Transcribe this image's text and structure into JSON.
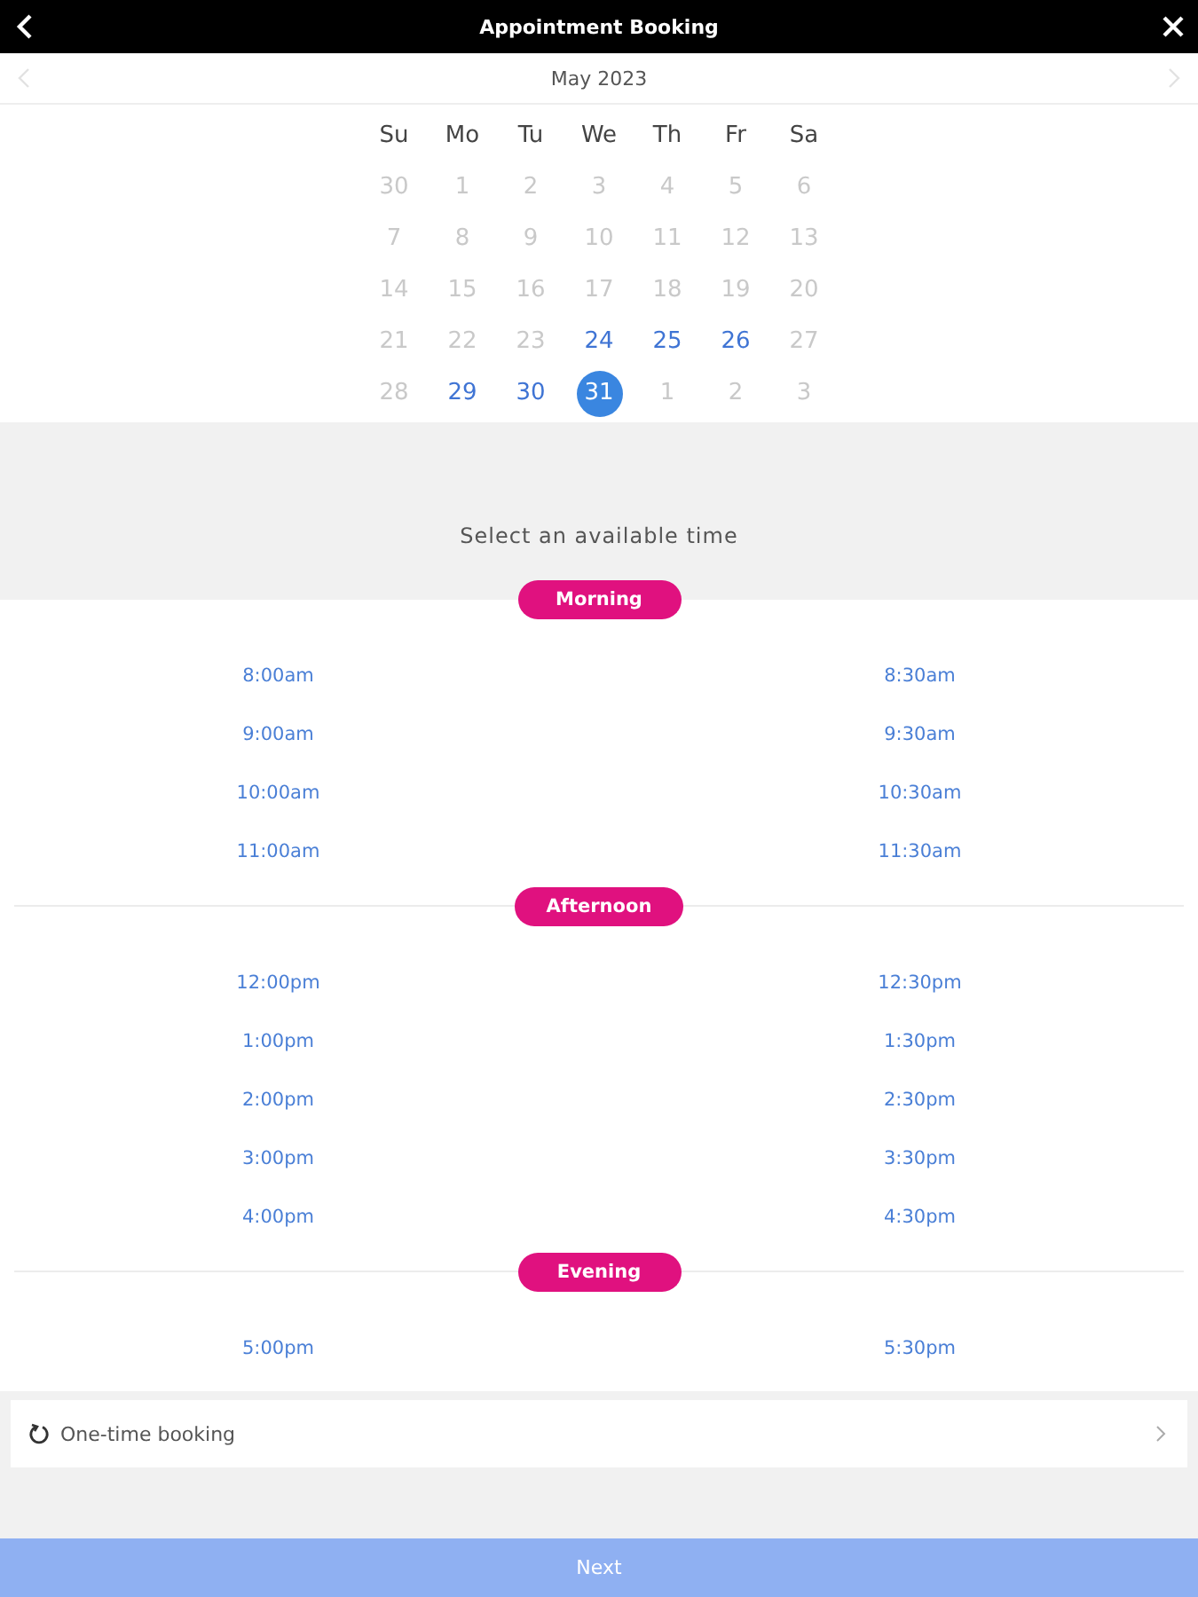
{
  "header": {
    "title": "Appointment Booking"
  },
  "month": {
    "label": "May 2023"
  },
  "weekdays": [
    "Su",
    "Mo",
    "Tu",
    "We",
    "Th",
    "Fr",
    "Sa"
  ],
  "days": [
    {
      "label": "30",
      "available": false,
      "selected": false
    },
    {
      "label": "1",
      "available": false,
      "selected": false
    },
    {
      "label": "2",
      "available": false,
      "selected": false
    },
    {
      "label": "3",
      "available": false,
      "selected": false
    },
    {
      "label": "4",
      "available": false,
      "selected": false
    },
    {
      "label": "5",
      "available": false,
      "selected": false
    },
    {
      "label": "6",
      "available": false,
      "selected": false
    },
    {
      "label": "7",
      "available": false,
      "selected": false
    },
    {
      "label": "8",
      "available": false,
      "selected": false
    },
    {
      "label": "9",
      "available": false,
      "selected": false
    },
    {
      "label": "10",
      "available": false,
      "selected": false
    },
    {
      "label": "11",
      "available": false,
      "selected": false
    },
    {
      "label": "12",
      "available": false,
      "selected": false
    },
    {
      "label": "13",
      "available": false,
      "selected": false
    },
    {
      "label": "14",
      "available": false,
      "selected": false
    },
    {
      "label": "15",
      "available": false,
      "selected": false
    },
    {
      "label": "16",
      "available": false,
      "selected": false
    },
    {
      "label": "17",
      "available": false,
      "selected": false
    },
    {
      "label": "18",
      "available": false,
      "selected": false
    },
    {
      "label": "19",
      "available": false,
      "selected": false
    },
    {
      "label": "20",
      "available": false,
      "selected": false
    },
    {
      "label": "21",
      "available": false,
      "selected": false
    },
    {
      "label": "22",
      "available": false,
      "selected": false
    },
    {
      "label": "23",
      "available": false,
      "selected": false
    },
    {
      "label": "24",
      "available": true,
      "selected": false
    },
    {
      "label": "25",
      "available": true,
      "selected": false
    },
    {
      "label": "26",
      "available": true,
      "selected": false
    },
    {
      "label": "27",
      "available": false,
      "selected": false
    },
    {
      "label": "28",
      "available": false,
      "selected": false
    },
    {
      "label": "29",
      "available": true,
      "selected": false
    },
    {
      "label": "30",
      "available": true,
      "selected": false
    },
    {
      "label": "31",
      "available": true,
      "selected": true
    },
    {
      "label": "1",
      "available": false,
      "selected": false
    },
    {
      "label": "2",
      "available": false,
      "selected": false
    },
    {
      "label": "3",
      "available": false,
      "selected": false
    }
  ],
  "prompt": "Select an available time",
  "sections": [
    {
      "label": "Morning",
      "times": [
        "8:00am",
        "8:30am",
        "9:00am",
        "9:30am",
        "10:00am",
        "10:30am",
        "11:00am",
        "11:30am"
      ]
    },
    {
      "label": "Afternoon",
      "times": [
        "12:00pm",
        "12:30pm",
        "1:00pm",
        "1:30pm",
        "2:00pm",
        "2:30pm",
        "3:00pm",
        "3:30pm",
        "4:00pm",
        "4:30pm"
      ]
    },
    {
      "label": "Evening",
      "times": [
        "5:00pm",
        "5:30pm"
      ]
    }
  ],
  "booking_type": {
    "label": "One-time booking"
  },
  "next_button": {
    "label": "Next",
    "disabled": true
  }
}
